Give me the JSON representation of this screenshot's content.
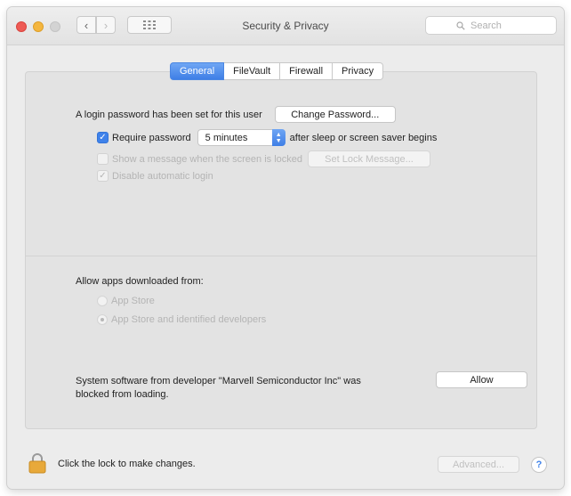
{
  "window": {
    "title": "Security & Privacy",
    "search_placeholder": "Search"
  },
  "tabs": [
    {
      "label": "General",
      "active": true
    },
    {
      "label": "FileVault",
      "active": false
    },
    {
      "label": "Firewall",
      "active": false
    },
    {
      "label": "Privacy",
      "active": false
    }
  ],
  "general": {
    "login_password_text": "A login password has been set for this user",
    "change_password_label": "Change Password...",
    "require_password_label": "Require password",
    "require_password_checked": true,
    "require_password_delay": "5 minutes",
    "require_password_suffix": "after sleep or screen saver begins",
    "show_message_label": "Show a message when the screen is locked",
    "show_message_checked": false,
    "set_lock_message_label": "Set Lock Message...",
    "disable_autologin_label": "Disable automatic login",
    "disable_autologin_checked": true
  },
  "allow_apps": {
    "heading": "Allow apps downloaded from:",
    "options": [
      {
        "label": "App Store",
        "selected": false
      },
      {
        "label": "App Store and identified developers",
        "selected": true
      }
    ]
  },
  "system_software": {
    "message_line1": "System software from developer \"Marvell Semiconductor Inc\" was",
    "message_line2": "blocked from loading.",
    "allow_label": "Allow"
  },
  "footer": {
    "lock_text": "Click the lock to make changes.",
    "advanced_label": "Advanced...",
    "help_label": "?"
  },
  "colors": {
    "accent": "#3f82ea",
    "window_bg": "#ececec",
    "lock": "#e8a93a"
  }
}
